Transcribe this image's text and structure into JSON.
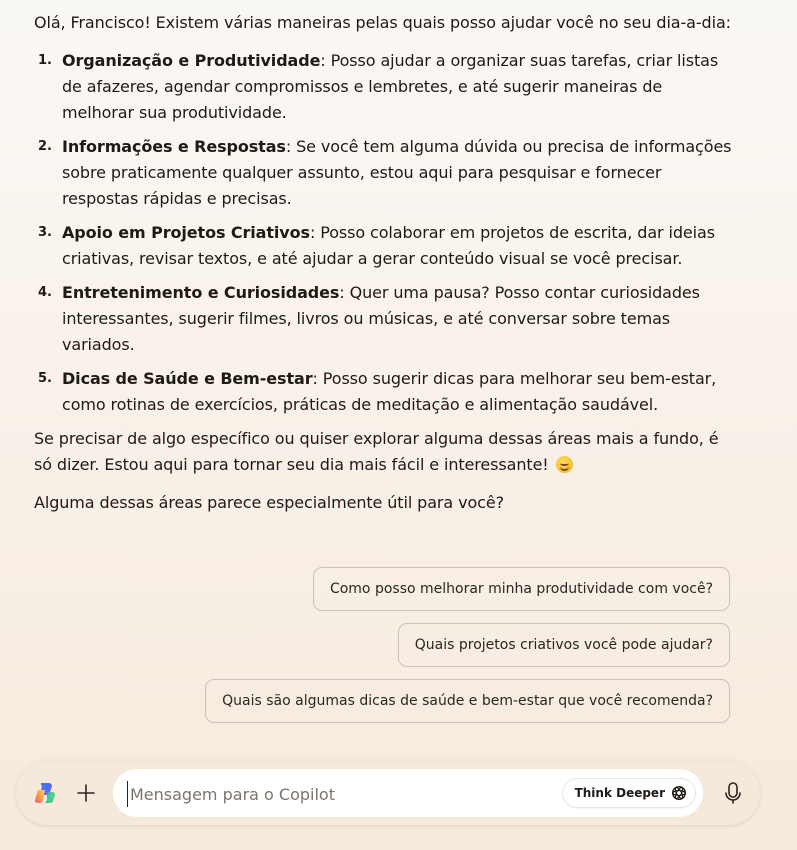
{
  "message": {
    "intro": "Olá, Francisco! Existem várias maneiras pelas quais posso ajudar você no seu dia-a-dia:",
    "items": [
      {
        "num": "1.",
        "title": "Organização e Produtividade",
        "text": ": Posso ajudar a organizar suas tarefas, criar listas de afazeres, agendar compromissos e lembretes, e até sugerir maneiras de melhorar sua produtividade."
      },
      {
        "num": "2.",
        "title": "Informações e Respostas",
        "text": ": Se você tem alguma dúvida ou precisa de informações sobre praticamente qualquer assunto, estou aqui para pesquisar e fornecer respostas rápidas e precisas."
      },
      {
        "num": "3.",
        "title": "Apoio em Projetos Criativos",
        "text": ": Posso colaborar em projetos de escrita, dar ideias criativas, revisar textos, e até ajudar a gerar conteúdo visual se você precisar."
      },
      {
        "num": "4.",
        "title": "Entretenimento e Curiosidades",
        "text": ": Quer uma pausa? Posso contar curiosidades interessantes, sugerir filmes, livros ou músicas, e até conversar sobre temas variados."
      },
      {
        "num": "5.",
        "title": "Dicas de Saúde e Bem-estar",
        "text": ": Posso sugerir dicas para melhorar seu bem-estar, como rotinas de exercícios, práticas de meditação e alimentação saudável."
      }
    ],
    "outro": "Se precisar de algo específico ou quiser explorar alguma dessas áreas mais a fundo, é só dizer. Estou aqui para tornar seu dia mais fácil e interessante!",
    "outro_emoji": "smiling-face-emoji",
    "question": "Alguma dessas áreas parece especialmente útil para você?"
  },
  "suggestions": [
    "Como posso melhorar minha produtividade com você?",
    "Quais projetos criativos você pode ajudar?",
    "Quais são algumas dicas de saúde e bem-estar que você recomenda?"
  ],
  "composer": {
    "logo_icon": "copilot-logo-icon",
    "add_icon": "plus-icon",
    "input_value": "",
    "input_placeholder": "Mensagem para o Copilot",
    "think_deeper_label": "Think Deeper",
    "think_icon": "think-deeper-icon",
    "mic_icon": "microphone-icon"
  }
}
